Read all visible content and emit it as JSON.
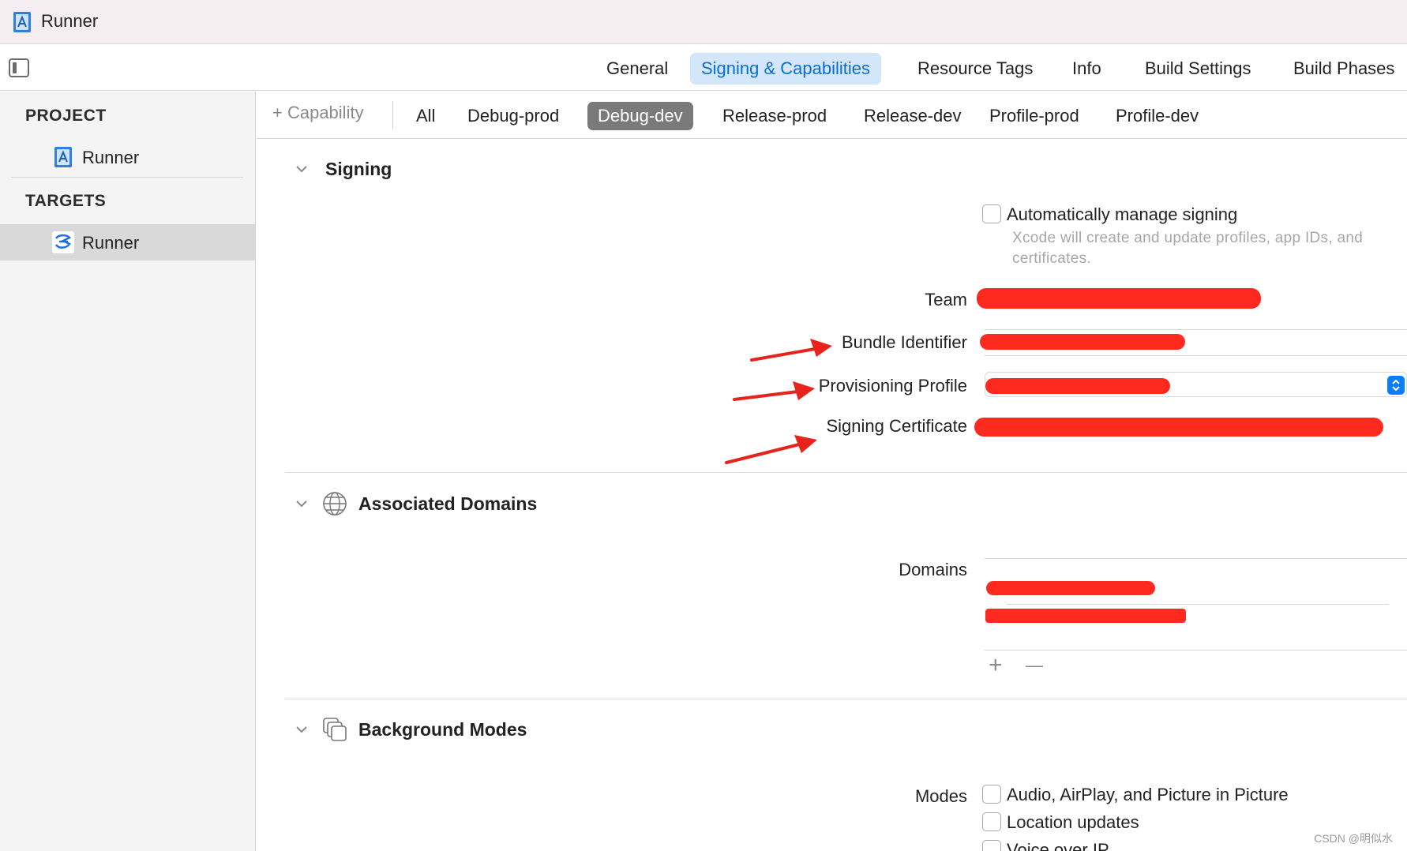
{
  "window": {
    "title": "Runner"
  },
  "tabs": [
    "General",
    "Signing & Capabilities",
    "Resource Tags",
    "Info",
    "Build Settings",
    "Build Phases"
  ],
  "active_tab": "Signing & Capabilities",
  "sidebar": {
    "project_header": "PROJECT",
    "project_item": "Runner",
    "targets_header": "TARGETS",
    "target_item": "Runner"
  },
  "config_bar": {
    "add_capability": "+ Capability",
    "configs": [
      "All",
      "Debug-prod",
      "Debug-dev",
      "Release-prod",
      "Release-dev",
      "Profile-prod",
      "Profile-dev"
    ],
    "active_config": "Debug-dev"
  },
  "signing": {
    "title": "Signing",
    "auto_manage_label": "Automatically manage signing",
    "auto_manage_checked": false,
    "auto_manage_hint": "Xcode will create and update profiles, app IDs, and certificates.",
    "team_label": "Team",
    "bundle_id_label": "Bundle Identifier",
    "provisioning_label": "Provisioning Profile",
    "certificate_label": "Signing Certificate"
  },
  "associated_domains": {
    "title": "Associated Domains",
    "domains_label": "Domains",
    "add_symbol": "+",
    "remove_symbol": "—"
  },
  "background_modes": {
    "title": "Background Modes",
    "modes_label": "Modes",
    "options": [
      {
        "label": "Audio, AirPlay, and Picture in Picture",
        "checked": false
      },
      {
        "label": "Location updates",
        "checked": false
      },
      {
        "label": "Voice over IP",
        "checked": false
      }
    ]
  },
  "annotation": {
    "redaction_color": "#ff2a1f",
    "arrow_color": "#e8231b"
  },
  "watermark": "CSDN @明似水"
}
